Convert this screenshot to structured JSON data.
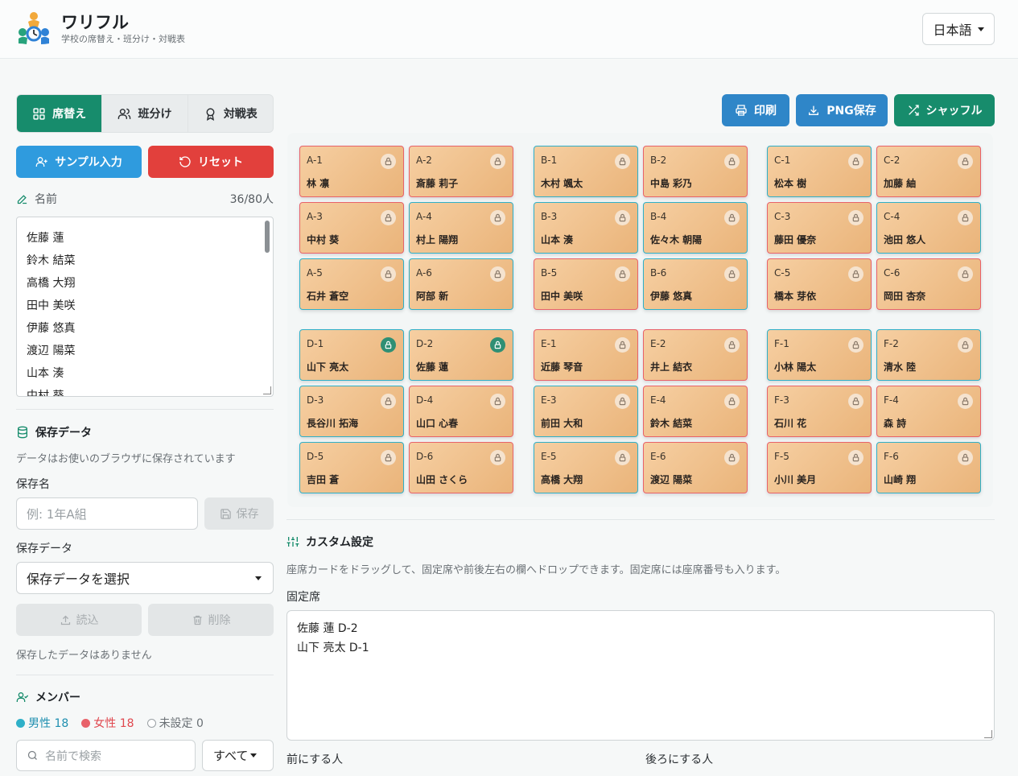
{
  "header": {
    "app_name": "ワリフル",
    "subtitle": "学校の席替え・班分け・対戦表",
    "language": "日本語"
  },
  "tabs": [
    {
      "label": "席替え",
      "icon": "grid-icon",
      "active": true
    },
    {
      "label": "班分け",
      "icon": "users-icon",
      "active": false
    },
    {
      "label": "対戦表",
      "icon": "award-icon",
      "active": false
    }
  ],
  "buttons": {
    "sample": "サンプル入力",
    "reset": "リセット"
  },
  "names": {
    "label": "名前",
    "count": "36/80人",
    "list": [
      "佐藤 蓮",
      "鈴木 結菜",
      "高橋 大翔",
      "田中 美咲",
      "伊藤 悠真",
      "渡辺 陽菜",
      "山本 湊",
      "中村 葵"
    ]
  },
  "saved": {
    "title": "保存データ",
    "note": "データはお使いのブラウザに保存されています",
    "name_label": "保存名",
    "name_placeholder": "例: 1年A組",
    "save_button": "保存",
    "data_label": "保存データ",
    "select_placeholder": "保存データを選択",
    "load_button": "読込",
    "delete_button": "削除",
    "empty_message": "保存したデータはありません"
  },
  "members": {
    "title": "メンバー",
    "male_label": "男性",
    "male_count": "18",
    "female_label": "女性",
    "female_count": "18",
    "unset_label": "未設定",
    "unset_count": "0",
    "search_placeholder": "名前で検索",
    "filter": "すべて"
  },
  "toolbar": {
    "print": "印刷",
    "png": "PNG保存",
    "shuffle": "シャッフル"
  },
  "colors": {
    "primary": "#178c6c",
    "blue": "#2f9bde",
    "red": "#e2403c",
    "male": "#2fb0c8",
    "female": "#e8626a"
  },
  "seats": [
    {
      "id": "A-1",
      "name": "林 凛",
      "gender": "female",
      "fixed": false
    },
    {
      "id": "A-2",
      "name": "斎藤 莉子",
      "gender": "female",
      "fixed": false
    },
    {
      "id": "B-1",
      "name": "木村 颯太",
      "gender": "male",
      "fixed": false
    },
    {
      "id": "B-2",
      "name": "中島 彩乃",
      "gender": "female",
      "fixed": false
    },
    {
      "id": "C-1",
      "name": "松本 樹",
      "gender": "male",
      "fixed": false
    },
    {
      "id": "C-2",
      "name": "加藤 紬",
      "gender": "female",
      "fixed": false
    },
    {
      "id": "A-3",
      "name": "中村 葵",
      "gender": "female",
      "fixed": false
    },
    {
      "id": "A-4",
      "name": "村上 陽翔",
      "gender": "male",
      "fixed": false
    },
    {
      "id": "B-3",
      "name": "山本 湊",
      "gender": "male",
      "fixed": false
    },
    {
      "id": "B-4",
      "name": "佐々木 朝陽",
      "gender": "male",
      "fixed": false
    },
    {
      "id": "C-3",
      "name": "藤田 優奈",
      "gender": "female",
      "fixed": false
    },
    {
      "id": "C-4",
      "name": "池田 悠人",
      "gender": "male",
      "fixed": false
    },
    {
      "id": "A-5",
      "name": "石井 蒼空",
      "gender": "male",
      "fixed": false
    },
    {
      "id": "A-6",
      "name": "阿部 新",
      "gender": "male",
      "fixed": false
    },
    {
      "id": "B-5",
      "name": "田中 美咲",
      "gender": "female",
      "fixed": false
    },
    {
      "id": "B-6",
      "name": "伊藤 悠真",
      "gender": "male",
      "fixed": false
    },
    {
      "id": "C-5",
      "name": "橋本 芽依",
      "gender": "female",
      "fixed": false
    },
    {
      "id": "C-6",
      "name": "岡田 杏奈",
      "gender": "female",
      "fixed": false
    },
    {
      "id": "D-1",
      "name": "山下 亮太",
      "gender": "male",
      "fixed": true
    },
    {
      "id": "D-2",
      "name": "佐藤 蓮",
      "gender": "male",
      "fixed": true
    },
    {
      "id": "E-1",
      "name": "近藤 琴音",
      "gender": "female",
      "fixed": false
    },
    {
      "id": "E-2",
      "name": "井上 結衣",
      "gender": "female",
      "fixed": false
    },
    {
      "id": "F-1",
      "name": "小林 陽太",
      "gender": "male",
      "fixed": false
    },
    {
      "id": "F-2",
      "name": "清水 陸",
      "gender": "male",
      "fixed": false
    },
    {
      "id": "D-3",
      "name": "長谷川 拓海",
      "gender": "male",
      "fixed": false
    },
    {
      "id": "D-4",
      "name": "山口 心春",
      "gender": "female",
      "fixed": false
    },
    {
      "id": "E-3",
      "name": "前田 大和",
      "gender": "male",
      "fixed": false
    },
    {
      "id": "E-4",
      "name": "鈴木 結菜",
      "gender": "female",
      "fixed": false
    },
    {
      "id": "F-3",
      "name": "石川 花",
      "gender": "female",
      "fixed": false
    },
    {
      "id": "F-4",
      "name": "森 詩",
      "gender": "female",
      "fixed": false
    },
    {
      "id": "D-5",
      "name": "吉田 蒼",
      "gender": "male",
      "fixed": false
    },
    {
      "id": "D-6",
      "name": "山田 さくら",
      "gender": "female",
      "fixed": false
    },
    {
      "id": "E-5",
      "name": "高橋 大翔",
      "gender": "male",
      "fixed": false
    },
    {
      "id": "E-6",
      "name": "渡辺 陽菜",
      "gender": "female",
      "fixed": false
    },
    {
      "id": "F-5",
      "name": "小川 美月",
      "gender": "female",
      "fixed": false
    },
    {
      "id": "F-6",
      "name": "山崎 翔",
      "gender": "male",
      "fixed": false
    }
  ],
  "custom": {
    "title": "カスタム設定",
    "description": "座席カードをドラッグして、固定席や前後左右の欄へドロップできます。固定席には座席番号も入ります。",
    "fixed_label": "固定席",
    "fixed_lines": [
      "佐藤 蓮 D-2",
      "山下 亮太 D-1"
    ],
    "front_label": "前にする人",
    "back_label": "後ろにする人"
  }
}
